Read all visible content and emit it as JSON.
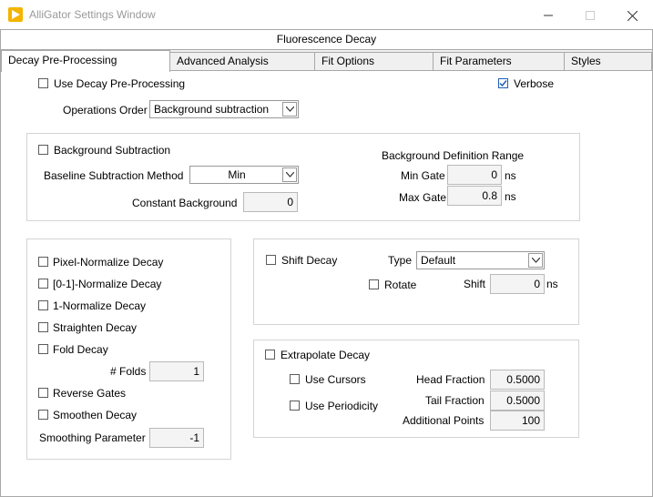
{
  "window": {
    "title": "AlliGator Settings Window"
  },
  "section_header": "Fluorescence Decay",
  "tabs": [
    {
      "label": "Decay Pre-Processing"
    },
    {
      "label": "Advanced Analysis"
    },
    {
      "label": "Fit Options"
    },
    {
      "label": "Fit Parameters"
    },
    {
      "label": "Styles"
    }
  ],
  "top": {
    "use_preprocessing": {
      "label": "Use Decay Pre-Processing",
      "checked": false
    },
    "verbose": {
      "label": "Verbose",
      "checked": true
    },
    "operations_order": {
      "label": "Operations Order",
      "value": "Background subtraction"
    }
  },
  "background": {
    "subtraction": {
      "label": "Background Subtraction",
      "checked": false
    },
    "method": {
      "label": "Baseline Subtraction Method",
      "value": "Min"
    },
    "constant": {
      "label": "Constant Background",
      "value": "0"
    },
    "range_title": "Background Definition Range",
    "min_gate": {
      "label": "Min Gate",
      "value": "0",
      "unit": "ns"
    },
    "max_gate": {
      "label": "Max Gate",
      "value": "0.8",
      "unit": "ns"
    }
  },
  "normalize": {
    "pixel": {
      "label": "Pixel-Normalize Decay",
      "checked": false
    },
    "zero_one": {
      "label": "[0-1]-Normalize Decay",
      "checked": false
    },
    "one": {
      "label": "1-Normalize Decay",
      "checked": false
    },
    "straighten": {
      "label": "Straighten Decay",
      "checked": false
    },
    "fold": {
      "label": "Fold Decay",
      "checked": false
    },
    "folds": {
      "label": "# Folds",
      "value": "1"
    },
    "reverse": {
      "label": "Reverse Gates",
      "checked": false
    },
    "smoothen": {
      "label": "Smoothen Decay",
      "checked": false
    },
    "smoothing": {
      "label": "Smoothing Parameter",
      "value": "-1"
    }
  },
  "shift": {
    "shift_decay": {
      "label": "Shift Decay",
      "checked": false
    },
    "type": {
      "label": "Type",
      "value": "Default"
    },
    "rotate": {
      "label": "Rotate",
      "checked": false
    },
    "shift": {
      "label": "Shift",
      "value": "0",
      "unit": "ns"
    }
  },
  "extrapolate": {
    "extrapolate_decay": {
      "label": "Extrapolate Decay",
      "checked": false
    },
    "use_cursors": {
      "label": "Use Cursors",
      "checked": false
    },
    "use_periodicity": {
      "label": "Use Periodicity",
      "checked": false
    },
    "head_fraction": {
      "label": "Head Fraction",
      "value": "0.5000"
    },
    "tail_fraction": {
      "label": "Tail Fraction",
      "value": "0.5000"
    },
    "additional_points": {
      "label": "Additional Points",
      "value": "100"
    }
  },
  "colors": {
    "check": "#1f5fb4",
    "app_icon": "#f4b400"
  },
  "icons": {
    "app": "play-icon",
    "minimize": "minimize-icon",
    "maximize": "maximize-icon",
    "close": "close-icon",
    "dropdown": "chevron-down-icon",
    "checkmark": "checkmark-icon"
  }
}
